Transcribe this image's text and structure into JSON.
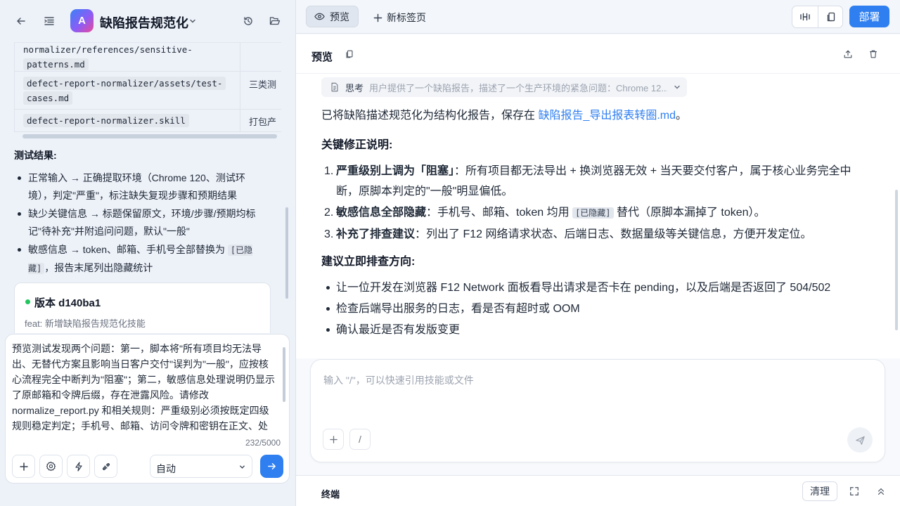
{
  "project": {
    "avatar_letter": "A",
    "title": "缺陷报告规范化"
  },
  "file_table": {
    "rows": [
      {
        "path": "normalizer/references/sensitive-patterns.md",
        "path_line1": "normalizer/references/sensitive-",
        "path_line2": "patterns.md",
        "desc": ""
      },
      {
        "path": "defect-report-normalizer/assets/test-cases.md",
        "path_line1": "defect-report-normalizer/assets/test-",
        "path_line2": "cases.md",
        "desc": "三类测"
      },
      {
        "path": "defect-report-normalizer.skill",
        "desc": "打包产"
      }
    ]
  },
  "test_results": {
    "title": "测试结果:",
    "items": [
      {
        "text": "正常输入 → 正确提取环境（Chrome 120、测试环境），判定\"严重\"，标注缺失复现步骤和预期结果"
      },
      {
        "text": "缺少关键信息 → 标题保留原文，环境/步骤/预期均标记\"待补充\"并附追问问题，默认\"一般\""
      },
      {
        "text_before": "敏感信息 → token、邮箱、手机号全部替换为 ",
        "code": "[已隐藏]",
        "text_after": "，报告末尾列出隐藏统计"
      }
    ]
  },
  "version_card": {
    "title": "版本 d140ba1",
    "subtitle": "feat: 新增缺陷报告规范化技能",
    "status_color": "#22c55e"
  },
  "composer": {
    "text": "预览测试发现两个问题：第一，脚本将\"所有项目均无法导出、无替代方案且影响当日客户交付\"误判为\"一般\"，应按核心流程完全中断判为\"阻塞\"；第二，敏感信息处理说明仍显示了原邮箱和令牌后缀，存在泄露风险。请修改 normalize_report.py 和相关规则：严重级别必须按既定四级规则稳定判定；手机号、邮箱、访问令牌和密钥在正文、处",
    "count": "232/5000",
    "mode": "自动"
  },
  "topbar": {
    "tab_preview": "预览",
    "tab_new": "新标签页",
    "deploy": "部署",
    "accent": "#2f7ff0"
  },
  "preview": {
    "title": "预览",
    "think_label": "思考",
    "think_preview": "用户提供了一个缺陷报告，描述了一个生产环境的紧急问题：Chrome 12...",
    "intro_before": "已将缺陷描述规范化为结构化报告，保存在 ",
    "intro_link": "缺陷报告_导出报表转圈.md",
    "intro_after": "。",
    "fix_heading": "关键修正说明:",
    "fixes": [
      {
        "num": "1.",
        "bold": "严重级别上调为「阻塞」",
        "text": "：所有项目都无法导出 + 换浏览器无效 + 当天要交付客户，属于核心业务完全中断，原脚本判定的\"一般\"明显偏低。"
      },
      {
        "num": "2.",
        "bold": "敏感信息全部隐藏",
        "text_before": "：手机号、邮箱、token 均用 ",
        "code": "[已隐藏]",
        "text_after": " 替代（原脚本漏掉了 token）。"
      },
      {
        "num": "3.",
        "bold": "补充了排查建议",
        "text": "：列出了 F12 网络请求状态、后端日志、数据量级等关键信息，方便开发定位。"
      }
    ],
    "suggest_heading": "建议立即排查方向:",
    "suggestions": [
      "让一位开发在浏览器 F12 Network 面板看导出请求是否卡在 pending，以及后端是否返回了 504/502",
      "检查后端导出服务的日志，看是否有超时或 OOM",
      "确认最近是否有发版变更"
    ]
  },
  "chat_input": {
    "placeholder": "输入 \"/\"，可以快速引用技能或文件",
    "slash": "/"
  },
  "terminal": {
    "title": "终端",
    "clear": "清理"
  }
}
